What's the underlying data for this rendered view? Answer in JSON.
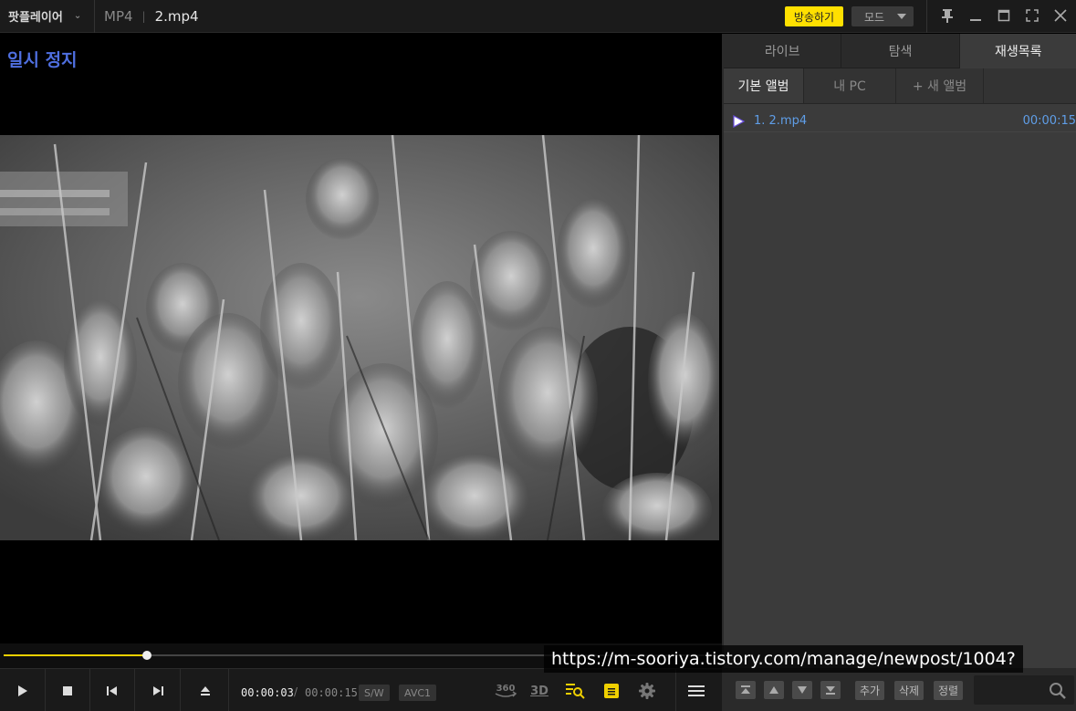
{
  "titlebar": {
    "app_name": "팟플레이어",
    "format": "MP4",
    "file_name": "2.mp4",
    "broadcast_label": "방송하기",
    "mode_label": "모드"
  },
  "video": {
    "status_text": "일시 정지",
    "seek_progress": 0.2
  },
  "controls": {
    "current_time": "00:00:03",
    "time_separator": "/",
    "total_time": "00:00:15",
    "sw_label": "S/W",
    "codec_label": "AVC1",
    "vr_label": "360",
    "threed_label": "3D"
  },
  "panel": {
    "tabs": [
      {
        "label": "라이브"
      },
      {
        "label": "탐색"
      },
      {
        "label": "재생목록"
      }
    ],
    "sub_tabs": [
      {
        "label": "기본 앨범"
      },
      {
        "label": "내 PC"
      },
      {
        "label": "+ 새 앨범"
      }
    ],
    "playlist": [
      {
        "name": "1. 2.mp4",
        "duration": "00:00:15"
      }
    ],
    "buttons": {
      "add": "추가",
      "delete": "삭제",
      "sort": "정렬"
    }
  },
  "overlay": {
    "url_text": "https://m-sooriya.tistory.com/manage/newpost/1004?"
  },
  "colors": {
    "accent_yellow": "#ffe000",
    "playlist_blue": "#5f9ee8",
    "pause_blue": "#4f6fe0"
  }
}
